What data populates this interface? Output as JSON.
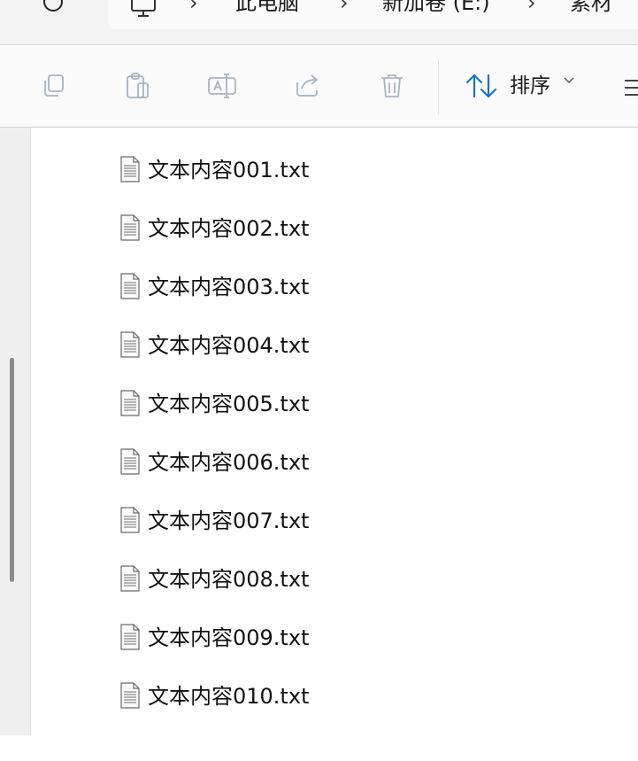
{
  "address_bar": {
    "crumbs": [
      "此电脑",
      "新加卷 (E:)",
      "素材"
    ],
    "separator": "›"
  },
  "toolbar": {
    "buttons": [
      {
        "name": "copy-button",
        "icon": "copy-icon"
      },
      {
        "name": "paste-button",
        "icon": "paste-icon"
      },
      {
        "name": "rename-button",
        "icon": "rename-icon"
      },
      {
        "name": "share-button",
        "icon": "share-icon"
      },
      {
        "name": "delete-button",
        "icon": "delete-icon"
      }
    ],
    "sort_label": "排序",
    "accent_color": "#1a73c7",
    "disabled_icon_color": "#a9b4bf"
  },
  "files": [
    {
      "name": "文本内容001.txt",
      "icon": "text-file-icon"
    },
    {
      "name": "文本内容002.txt",
      "icon": "text-file-icon"
    },
    {
      "name": "文本内容003.txt",
      "icon": "text-file-icon"
    },
    {
      "name": "文本内容004.txt",
      "icon": "text-file-icon"
    },
    {
      "name": "文本内容005.txt",
      "icon": "text-file-icon"
    },
    {
      "name": "文本内容006.txt",
      "icon": "text-file-icon"
    },
    {
      "name": "文本内容007.txt",
      "icon": "text-file-icon"
    },
    {
      "name": "文本内容008.txt",
      "icon": "text-file-icon"
    },
    {
      "name": "文本内容009.txt",
      "icon": "text-file-icon"
    },
    {
      "name": "文本内容010.txt",
      "icon": "text-file-icon"
    }
  ]
}
